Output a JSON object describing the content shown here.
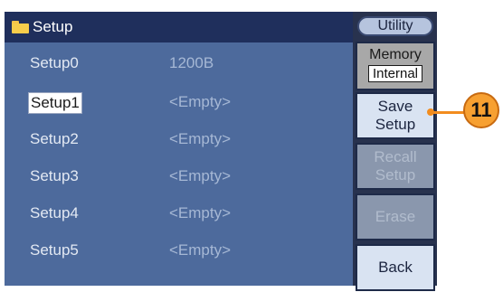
{
  "header": {
    "title": "Setup"
  },
  "setups": [
    {
      "name": "Setup0",
      "value": "1200B"
    },
    {
      "name": "Setup1",
      "value": "<Empty>"
    },
    {
      "name": "Setup2",
      "value": "<Empty>"
    },
    {
      "name": "Setup3",
      "value": "<Empty>"
    },
    {
      "name": "Setup4",
      "value": "<Empty>"
    },
    {
      "name": "Setup5",
      "value": "<Empty>"
    }
  ],
  "menu": {
    "utility": "Utility",
    "memory_label": "Memory",
    "memory_value": "Internal",
    "save_line1": "Save",
    "save_line2": "Setup",
    "recall_line1": "Recall",
    "recall_line2": "Setup",
    "erase": "Erase",
    "back": "Back"
  },
  "callout": {
    "number": "11"
  },
  "colors": {
    "accent": "#f7a031",
    "panel": "#4d6a9c",
    "title_bar": "#1f2f5c"
  }
}
